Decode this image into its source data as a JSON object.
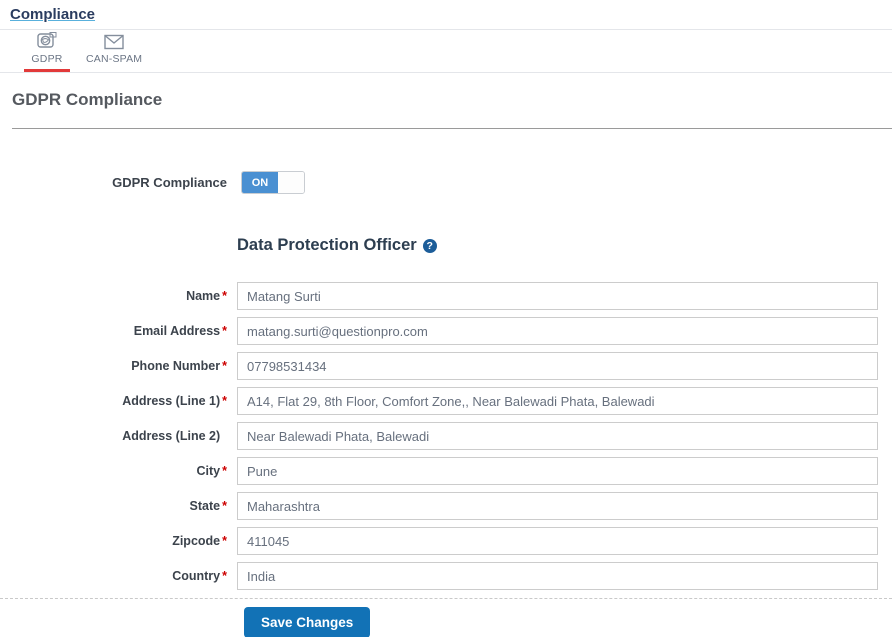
{
  "header": {
    "breadcrumb": "Compliance"
  },
  "tabs": [
    {
      "label": "GDPR",
      "icon": "gdpr-badge-icon",
      "active": true
    },
    {
      "label": "CAN-SPAM",
      "icon": "envelope-icon",
      "active": false
    }
  ],
  "section": {
    "heading": "GDPR Compliance"
  },
  "toggle": {
    "label": "GDPR Compliance",
    "state": "ON"
  },
  "dpo": {
    "heading": "Data Protection Officer",
    "help_icon": "question-mark-icon",
    "help_glyph": "?"
  },
  "form": {
    "fields": [
      {
        "id": "name",
        "label": "Name",
        "required": true,
        "value": "Matang Surti"
      },
      {
        "id": "email",
        "label": "Email Address",
        "required": true,
        "value": "matang.surti@questionpro.com"
      },
      {
        "id": "phone",
        "label": "Phone Number",
        "required": true,
        "value": "07798531434"
      },
      {
        "id": "address1",
        "label": "Address (Line 1)",
        "required": true,
        "value": "A14, Flat 29, 8th Floor, Comfort Zone,, Near Balewadi Phata, Balewadi"
      },
      {
        "id": "address2",
        "label": "Address (Line 2)",
        "required": false,
        "value": "Near Balewadi Phata, Balewadi"
      },
      {
        "id": "city",
        "label": "City",
        "required": true,
        "value": "Pune"
      },
      {
        "id": "state",
        "label": "State",
        "required": true,
        "value": "Maharashtra"
      },
      {
        "id": "zipcode",
        "label": "Zipcode",
        "required": true,
        "value": "411045"
      },
      {
        "id": "country",
        "label": "Country",
        "required": true,
        "value": "India"
      }
    ],
    "save_label": "Save Changes"
  },
  "colors": {
    "link": "#2a3c5f",
    "link_underline": "#58b0dc",
    "tab_active_underline": "#e23a3a",
    "toggle_on": "#4a90d2",
    "help_icon_bg": "#1c5d99",
    "required_asterisk": "#cc0000",
    "save_button_bg": "#1272b6",
    "input_border": "#cccccc"
  }
}
